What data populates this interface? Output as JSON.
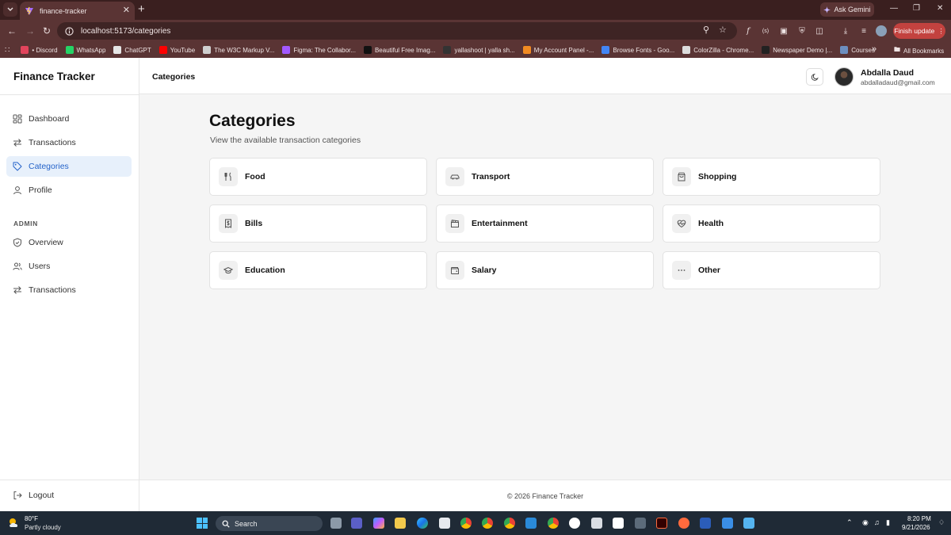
{
  "browser": {
    "tab_title": "finance-tracker",
    "tab_close": "✕",
    "new_tab": "+",
    "ask_gemini": "Ask Gemini",
    "url": "localhost:5173/categories",
    "finish_update": "Finish update",
    "bookmarks": [
      {
        "label": "• Discord",
        "color": "#e2445c"
      },
      {
        "label": "WhatsApp",
        "color": "#25d366"
      },
      {
        "label": "ChatGPT",
        "color": "#e6e6e6"
      },
      {
        "label": "YouTube",
        "color": "#ff0000"
      },
      {
        "label": "The W3C Markup V...",
        "color": "#cfcfcf"
      },
      {
        "label": "Figma: The Collabor...",
        "color": "#a259ff"
      },
      {
        "label": "Beautiful Free Imag...",
        "color": "#111111"
      },
      {
        "label": "yallashoot | yalla sh...",
        "color": "#333333"
      },
      {
        "label": "My Account Panel -...",
        "color": "#f28b22"
      },
      {
        "label": "Browse Fonts - Goo...",
        "color": "#4285f4"
      },
      {
        "label": "ColorZilla - Chrome...",
        "color": "#dddddd"
      },
      {
        "label": "Newspaper Demo |...",
        "color": "#222222"
      },
      {
        "label": "Courses",
        "color": "#6c8ebf"
      }
    ],
    "all_bookmarks": "All Bookmarks"
  },
  "app": {
    "brand": "Finance Tracker",
    "header_title": "Categories",
    "user": {
      "name": "Abdalla Daud",
      "email": "abdalladaud@gmail.com"
    },
    "nav": [
      {
        "label": "Dashboard",
        "icon": "dashboard-icon",
        "active": false
      },
      {
        "label": "Transactions",
        "icon": "transactions-icon",
        "active": false
      },
      {
        "label": "Categories",
        "icon": "tag-icon",
        "active": true
      },
      {
        "label": "Profile",
        "icon": "user-icon",
        "active": false
      }
    ],
    "admin_label": "ADMIN",
    "admin_nav": [
      {
        "label": "Overview",
        "icon": "shield-icon"
      },
      {
        "label": "Users",
        "icon": "users-icon"
      },
      {
        "label": "Transactions",
        "icon": "transactions-icon"
      }
    ],
    "logout": "Logout",
    "page_title": "Categories",
    "page_subtitle": "View the available transaction categories",
    "categories": [
      {
        "label": "Food",
        "icon": "utensils-icon"
      },
      {
        "label": "Transport",
        "icon": "car-icon"
      },
      {
        "label": "Shopping",
        "icon": "shopping-bag-icon"
      },
      {
        "label": "Bills",
        "icon": "receipt-icon"
      },
      {
        "label": "Entertainment",
        "icon": "clapperboard-icon"
      },
      {
        "label": "Health",
        "icon": "heart-pulse-icon"
      },
      {
        "label": "Education",
        "icon": "graduation-cap-icon"
      },
      {
        "label": "Salary",
        "icon": "wallet-icon"
      },
      {
        "label": "Other",
        "icon": "ellipsis-icon"
      }
    ],
    "footer": "© 2026 Finance Tracker",
    "accent_color": "#2563c9"
  },
  "taskbar": {
    "temperature": "80°F",
    "weather": "Partly cloudy",
    "search": "Search",
    "time": "8:20 PM",
    "date": "9/21/2026"
  }
}
